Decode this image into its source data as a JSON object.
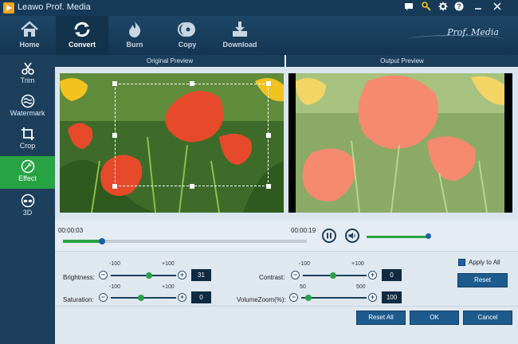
{
  "window": {
    "title": "Leawo Prof. Media",
    "brand": "Prof. Media"
  },
  "toolbar": {
    "items": [
      {
        "label": "Home",
        "icon": "home-icon"
      },
      {
        "label": "Convert",
        "icon": "convert-icon"
      },
      {
        "label": "Burn",
        "icon": "burn-icon"
      },
      {
        "label": "Copy",
        "icon": "copy-icon"
      },
      {
        "label": "Download",
        "icon": "download-icon"
      }
    ],
    "active": "Convert"
  },
  "sidebar": {
    "items": [
      {
        "label": "Trim",
        "icon": "scissors-icon"
      },
      {
        "label": "Watermark",
        "icon": "watermark-icon"
      },
      {
        "label": "Crop",
        "icon": "crop-icon"
      },
      {
        "label": "Effect",
        "icon": "effect-icon"
      },
      {
        "label": "3D",
        "icon": "3d-glasses-icon"
      }
    ],
    "active": "Effect"
  },
  "preview": {
    "original_label": "Original Preview",
    "output_label": "Output Preview"
  },
  "playback": {
    "current_time": "00:00:03",
    "total_time": "00:00:19",
    "progress_fraction": 0.16,
    "volume_fraction": 1.0
  },
  "effects": {
    "brightness": {
      "label": "Brightness:",
      "min": "-100",
      "max": "+100",
      "value": "31"
    },
    "saturation": {
      "label": "Saturation:",
      "min": "-100",
      "max": "+100",
      "value": "0"
    },
    "contrast": {
      "label": "Contrast:",
      "min": "-100",
      "max": "+100",
      "value": "0"
    },
    "volume_zoom": {
      "label": "VolumeZoom(%):",
      "min": "50",
      "max": "500",
      "value": "100"
    },
    "apply_all_label": "Apply to All",
    "reset_label": "Reset"
  },
  "footer": {
    "reset_all_label": "Reset All",
    "ok_label": "OK",
    "cancel_label": "Cancel"
  },
  "colors": {
    "accent_green": "#27a344",
    "nav_dark": "#1d3f5c",
    "button_blue": "#1d5b8e"
  }
}
